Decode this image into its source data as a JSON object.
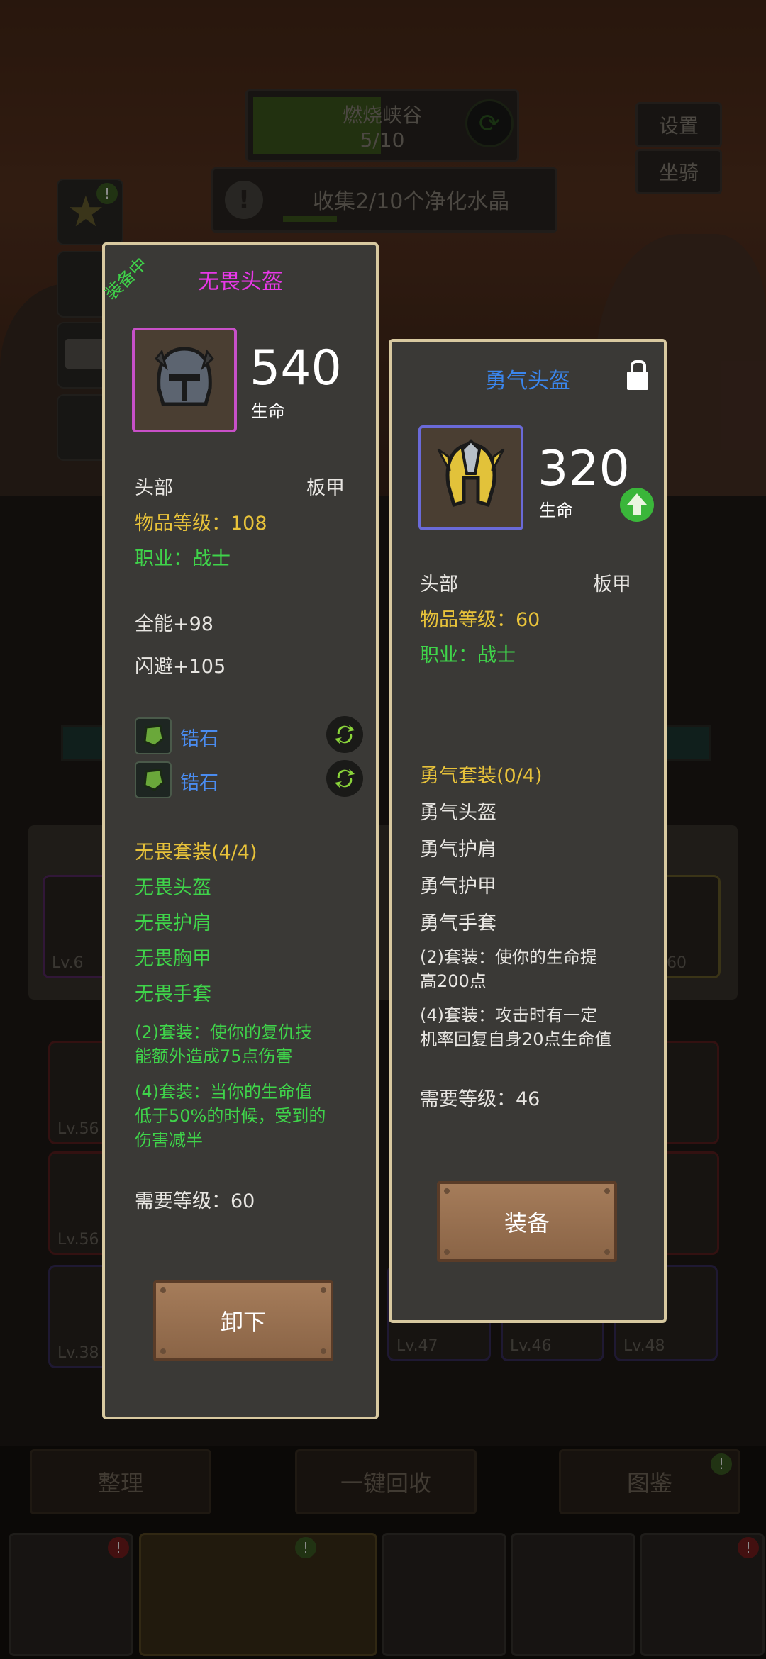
{
  "hud": {
    "area_name": "燃烧峡谷",
    "area_progress": "5/10",
    "quest_text": "收集2/10个净化水晶",
    "settings_label": "设置",
    "mount_label": "坐骑"
  },
  "background": {
    "slot_levels": [
      "Lv.6",
      ".60",
      "Lv.56",
      "Lv.56",
      "Lv.38",
      "Lv.47",
      "Lv.46",
      "Lv.48"
    ],
    "buttons": {
      "sort": "整理",
      "recycle": "一键回收",
      "codex": "图鉴"
    }
  },
  "equipped": {
    "tag": "装备中",
    "name": "无畏头盔",
    "stat_value": "540",
    "stat_label": "生命",
    "slot": "头部",
    "armor_type": "板甲",
    "item_level": "物品等级：108",
    "class": "职业：战士",
    "bonuses": [
      "全能+98",
      "闪避+105"
    ],
    "gems": [
      "锆石",
      "锆石"
    ],
    "set_title": "无畏套装(4/4)",
    "set_pieces": [
      "无畏头盔",
      "无畏护肩",
      "无畏胸甲",
      "无畏手套"
    ],
    "set_bonus_2": [
      "(2)套装：使你的复仇技",
      "能额外造成75点伤害"
    ],
    "set_bonus_4": [
      "(4)套装：当你的生命值",
      "低于50%的时候，受到的",
      "伤害减半"
    ],
    "required_level": "需要等级：60",
    "action": "卸下",
    "colors": {
      "title": "#e838e8",
      "icon_border": "#c850c8"
    }
  },
  "compare": {
    "name": "勇气头盔",
    "stat_value": "320",
    "stat_label": "生命",
    "slot": "头部",
    "armor_type": "板甲",
    "item_level": "物品等级：60",
    "class": "职业：战士",
    "set_title": "勇气套装(0/4)",
    "set_pieces": [
      "勇气头盔",
      "勇气护肩",
      "勇气护甲",
      "勇气手套"
    ],
    "set_bonus_2": [
      "(2)套装：使你的生命提",
      "高200点"
    ],
    "set_bonus_4": [
      "(4)套装：攻击时有一定",
      "机率回复自身20点生命值"
    ],
    "required_level": "需要等级：46",
    "action": "装备",
    "colors": {
      "title": "#3a86ee",
      "icon_border": "#6a6ad8"
    }
  }
}
